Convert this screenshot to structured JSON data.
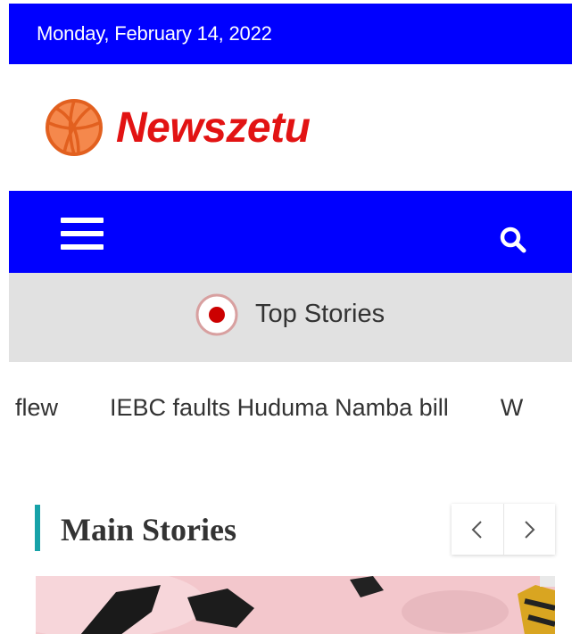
{
  "topbar": {
    "date": "Monday, February 14, 2022",
    "background": "#0000ff"
  },
  "brand": {
    "site_name": "Newszetu",
    "logo_icon": "basketball-icon",
    "text_color": "#e21313"
  },
  "navbar": {
    "menu_icon": "hamburger-icon",
    "search_icon": "search-icon",
    "background": "#0000ff"
  },
  "top_stories": {
    "label": "Top Stories",
    "icon": "live-dot-icon"
  },
  "ticker": {
    "items": [
      {
        "text": "s flew"
      },
      {
        "text": "IEBC faults Huduma Namba bill"
      },
      {
        "text": "W"
      }
    ]
  },
  "main_stories": {
    "title": "Main Stories",
    "accent_color": "#17a2a8",
    "prev_icon": "chevron-left-icon",
    "next_icon": "chevron-right-icon"
  }
}
